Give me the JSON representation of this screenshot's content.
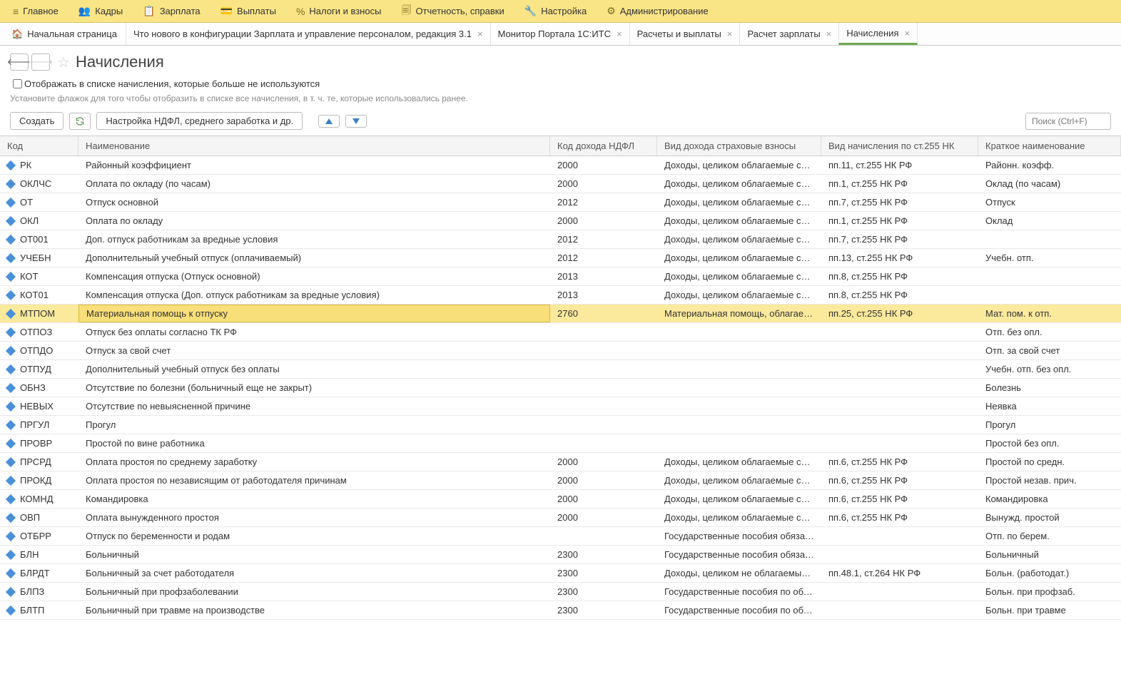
{
  "mainMenu": [
    {
      "icon": "≡",
      "label": "Главное"
    },
    {
      "icon": "👥",
      "label": "Кадры"
    },
    {
      "icon": "📋",
      "label": "Зарплата"
    },
    {
      "icon": "💳",
      "label": "Выплаты"
    },
    {
      "icon": "%",
      "label": "Налоги и взносы"
    },
    {
      "icon": "🗐",
      "label": "Отчетность, справки"
    },
    {
      "icon": "🔧",
      "label": "Настройка"
    },
    {
      "icon": "⚙",
      "label": "Администрирование"
    }
  ],
  "homeTab": "Начальная страница",
  "tabs": [
    {
      "label": "Что нового в конфигурации Зарплата и управление персоналом, редакция 3.1",
      "active": false
    },
    {
      "label": "Монитор Портала 1С:ИТС",
      "active": false
    },
    {
      "label": "Расчеты и выплаты",
      "active": false
    },
    {
      "label": "Расчет зарплаты",
      "active": false
    },
    {
      "label": "Начисления",
      "active": true
    }
  ],
  "pageTitle": "Начисления",
  "filterCheckboxLabel": "Отображать в списке начисления, которые больше не используются",
  "filterHint": "Установите флажок для того чтобы отобразить в списке все начисления, в т. ч. те, которые использовались ранее.",
  "toolbar": {
    "createLabel": "Создать",
    "settingsLabel": "Настройка НДФЛ, среднего заработка и др."
  },
  "searchPlaceholder": "Поиск (Ctrl+F)",
  "columns": {
    "code": "Код",
    "name": "Наименование",
    "ndfl": "Код дохода НДФЛ",
    "insurance": "Вид дохода страховые взносы",
    "st255": "Вид начисления по ст.255 НК",
    "short": "Краткое наименование"
  },
  "rows": [
    {
      "code": "РК",
      "name": "Районный коэффициент",
      "ndfl": "2000",
      "ins": "Доходы, целиком облагаемые страхо...",
      "st255": "пп.11, ст.255 НК РФ",
      "short": "Районн. коэфф."
    },
    {
      "code": "ОКЛЧС",
      "name": "Оплата по окладу (по часам)",
      "ndfl": "2000",
      "ins": "Доходы, целиком облагаемые страхо...",
      "st255": "пп.1, ст.255 НК РФ",
      "short": "Оклад (по часам)"
    },
    {
      "code": "ОТ",
      "name": "Отпуск основной",
      "ndfl": "2012",
      "ins": "Доходы, целиком облагаемые страхо...",
      "st255": "пп.7, ст.255 НК РФ",
      "short": "Отпуск"
    },
    {
      "code": "ОКЛ",
      "name": "Оплата по окладу",
      "ndfl": "2000",
      "ins": "Доходы, целиком облагаемые страхо...",
      "st255": "пп.1, ст.255 НК РФ",
      "short": "Оклад"
    },
    {
      "code": "ОТ001",
      "name": "Доп. отпуск работникам за вредные условия",
      "ndfl": "2012",
      "ins": "Доходы, целиком облагаемые страхо...",
      "st255": "пп.7, ст.255 НК РФ",
      "short": ""
    },
    {
      "code": "УЧЕБН",
      "name": "Дополнительный учебный отпуск (оплачиваемый)",
      "ndfl": "2012",
      "ins": "Доходы, целиком облагаемые страхо...",
      "st255": "пп.13, ст.255 НК РФ",
      "short": "Учебн. отп."
    },
    {
      "code": "КОТ",
      "name": "Компенсация отпуска (Отпуск основной)",
      "ndfl": "2013",
      "ins": "Доходы, целиком облагаемые страхо...",
      "st255": "пп.8, ст.255 НК РФ",
      "short": ""
    },
    {
      "code": "КОТ01",
      "name": "Компенсация отпуска (Доп. отпуск работникам за вредные условия)",
      "ndfl": "2013",
      "ins": "Доходы, целиком облагаемые страхо...",
      "st255": "пп.8, ст.255 НК РФ",
      "short": ""
    },
    {
      "code": "МТПОМ",
      "name": "Материальная помощь к отпуску",
      "ndfl": "2760",
      "ins": "Материальная помощь, облагаемая с...",
      "st255": "пп.25, ст.255 НК РФ",
      "short": "Мат. пом. к отп.",
      "selected": true
    },
    {
      "code": "ОТПОЗ",
      "name": "Отпуск без оплаты согласно ТК РФ",
      "ndfl": "",
      "ins": "",
      "st255": "",
      "short": "Отп. без опл."
    },
    {
      "code": "ОТПДО",
      "name": "Отпуск за свой счет",
      "ndfl": "",
      "ins": "",
      "st255": "",
      "short": "Отп. за свой счет"
    },
    {
      "code": "ОТПУД",
      "name": "Дополнительный учебный отпуск без оплаты",
      "ndfl": "",
      "ins": "",
      "st255": "",
      "short": "Учебн. отп. без опл."
    },
    {
      "code": "ОБНЗ",
      "name": "Отсутствие по болезни (больничный еще не закрыт)",
      "ndfl": "",
      "ins": "",
      "st255": "",
      "short": "Болезнь"
    },
    {
      "code": "НЕВЫХ",
      "name": "Отсутствие по невыясненной причине",
      "ndfl": "",
      "ins": "",
      "st255": "",
      "short": "Неявка"
    },
    {
      "code": "ПРГУЛ",
      "name": "Прогул",
      "ndfl": "",
      "ins": "",
      "st255": "",
      "short": "Прогул"
    },
    {
      "code": "ПРОВР",
      "name": "Простой по вине работника",
      "ndfl": "",
      "ins": "",
      "st255": "",
      "short": "Простой без опл."
    },
    {
      "code": "ПРСРД",
      "name": "Оплата простоя по среднему заработку",
      "ndfl": "2000",
      "ins": "Доходы, целиком облагаемые страхо...",
      "st255": "пп.6, ст.255 НК РФ",
      "short": "Простой по средн."
    },
    {
      "code": "ПРОКД",
      "name": "Оплата простоя по независящим от работодателя причинам",
      "ndfl": "2000",
      "ins": "Доходы, целиком облагаемые страхо...",
      "st255": "пп.6, ст.255 НК РФ",
      "short": "Простой незав. прич."
    },
    {
      "code": "КОМНД",
      "name": "Командировка",
      "ndfl": "2000",
      "ins": "Доходы, целиком облагаемые страхо...",
      "st255": "пп.6, ст.255 НК РФ",
      "short": "Командировка"
    },
    {
      "code": "ОВП",
      "name": "Оплата вынужденного простоя",
      "ndfl": "2000",
      "ins": "Доходы, целиком облагаемые страхо...",
      "st255": "пп.6, ст.255 НК РФ",
      "short": "Вынужд. простой"
    },
    {
      "code": "ОТБРР",
      "name": "Отпуск по беременности и родам",
      "ndfl": "",
      "ins": "Государственные пособия обязательн...",
      "st255": "",
      "short": "Отп. по берем."
    },
    {
      "code": "БЛН",
      "name": "Больничный",
      "ndfl": "2300",
      "ins": "Государственные пособия обязательн...",
      "st255": "",
      "short": "Больничный"
    },
    {
      "code": "БЛРДТ",
      "name": "Больничный за счет работодателя",
      "ndfl": "2300",
      "ins": "Доходы, целиком не облагаемые стра...",
      "st255": "пп.48.1, ст.264 НК РФ",
      "short": "Больн. (работодат.)"
    },
    {
      "code": "БЛПЗ",
      "name": "Больничный при профзаболевании",
      "ndfl": "2300",
      "ins": "Государственные пособия по обязате...",
      "st255": "",
      "short": "Больн. при профзаб."
    },
    {
      "code": "БЛТП",
      "name": "Больничный при травме на производстве",
      "ndfl": "2300",
      "ins": "Государственные пособия по обязате...",
      "st255": "",
      "short": "Больн. при травме"
    }
  ]
}
